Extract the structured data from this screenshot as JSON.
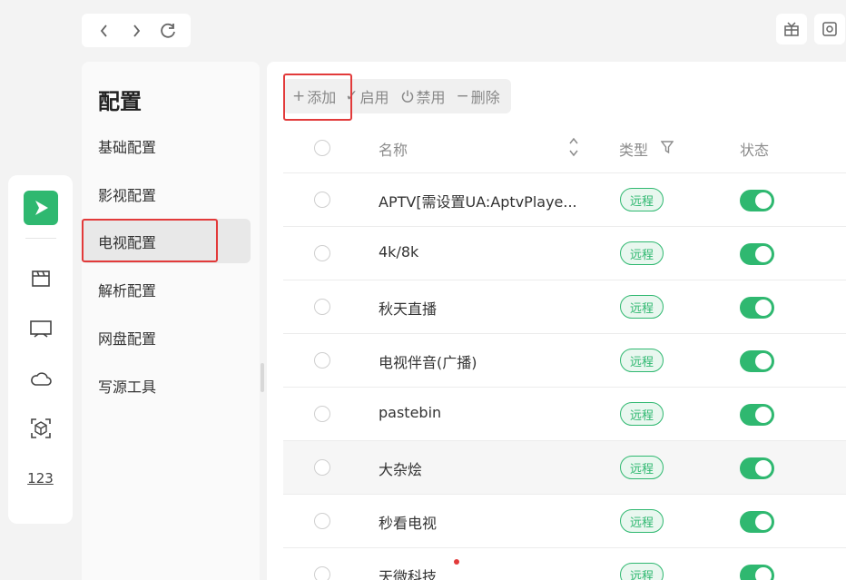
{
  "nav": {
    "back": "‹",
    "forward": "›"
  },
  "sidebar": {
    "title": "配置",
    "items": [
      {
        "label": "基础配置"
      },
      {
        "label": "影视配置"
      },
      {
        "label": "电视配置",
        "active": true
      },
      {
        "label": "解析配置"
      },
      {
        "label": "网盘配置"
      },
      {
        "label": "写源工具"
      }
    ]
  },
  "rail": {
    "icons": [
      "logo-icon",
      "film-icon",
      "tv-icon",
      "cloud-icon",
      "cube-scan-icon",
      "numbers-icon"
    ],
    "numbers_label": "123"
  },
  "toolbar": {
    "add_label": "添加",
    "enable_label": "启用",
    "disable_label": "禁用",
    "delete_label": "删除"
  },
  "table": {
    "headers": {
      "name": "名称",
      "type": "类型",
      "status": "状态"
    },
    "rows": [
      {
        "name": "APTV[需设置UA:AptvPlaye...",
        "type": "远程",
        "enabled": true
      },
      {
        "name": "4k/8k",
        "type": "远程",
        "enabled": true
      },
      {
        "name": "秋天直播",
        "type": "远程",
        "enabled": true
      },
      {
        "name": "电视伴音(广播)",
        "type": "远程",
        "enabled": true
      },
      {
        "name": "pastebin",
        "type": "远程",
        "enabled": true
      },
      {
        "name": "大杂烩",
        "type": "远程",
        "enabled": true
      },
      {
        "name": "秒看电视",
        "type": "远程",
        "enabled": true
      },
      {
        "name": "天微科技",
        "type": "远程",
        "enabled": true
      }
    ]
  },
  "colors": {
    "accent": "#2fb870",
    "highlight_box": "#e23a3a"
  }
}
